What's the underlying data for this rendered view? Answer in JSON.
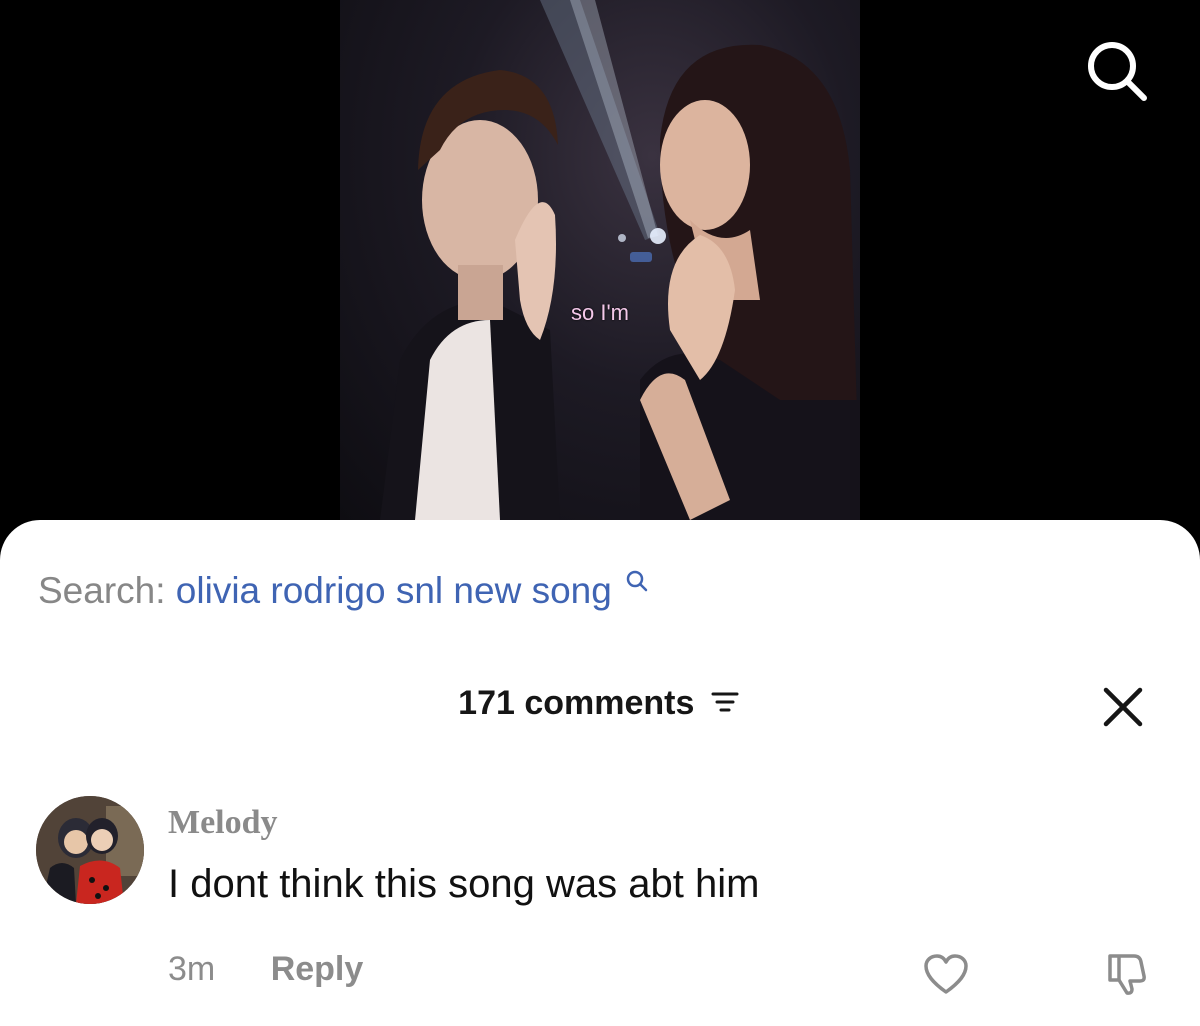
{
  "video": {
    "caption": "so I'm"
  },
  "search": {
    "prefix": "Search:",
    "query": "olivia rodrigo snl new song"
  },
  "comments_panel": {
    "count_label": "171 comments"
  },
  "comments": [
    {
      "username": "Melody",
      "text": "I dont think this song was abt him",
      "time": "3m",
      "reply_label": "Reply"
    }
  ],
  "icons": {
    "top_search": "search-icon",
    "search_suggest": "search-icon",
    "sort": "filter-icon",
    "close": "close-icon",
    "like": "heart-icon",
    "dislike": "thumbs-down-icon"
  },
  "colors": {
    "search_query": "#3f64b3",
    "caption": "#f4c8ea",
    "muted_text": "#8c8c8c"
  }
}
